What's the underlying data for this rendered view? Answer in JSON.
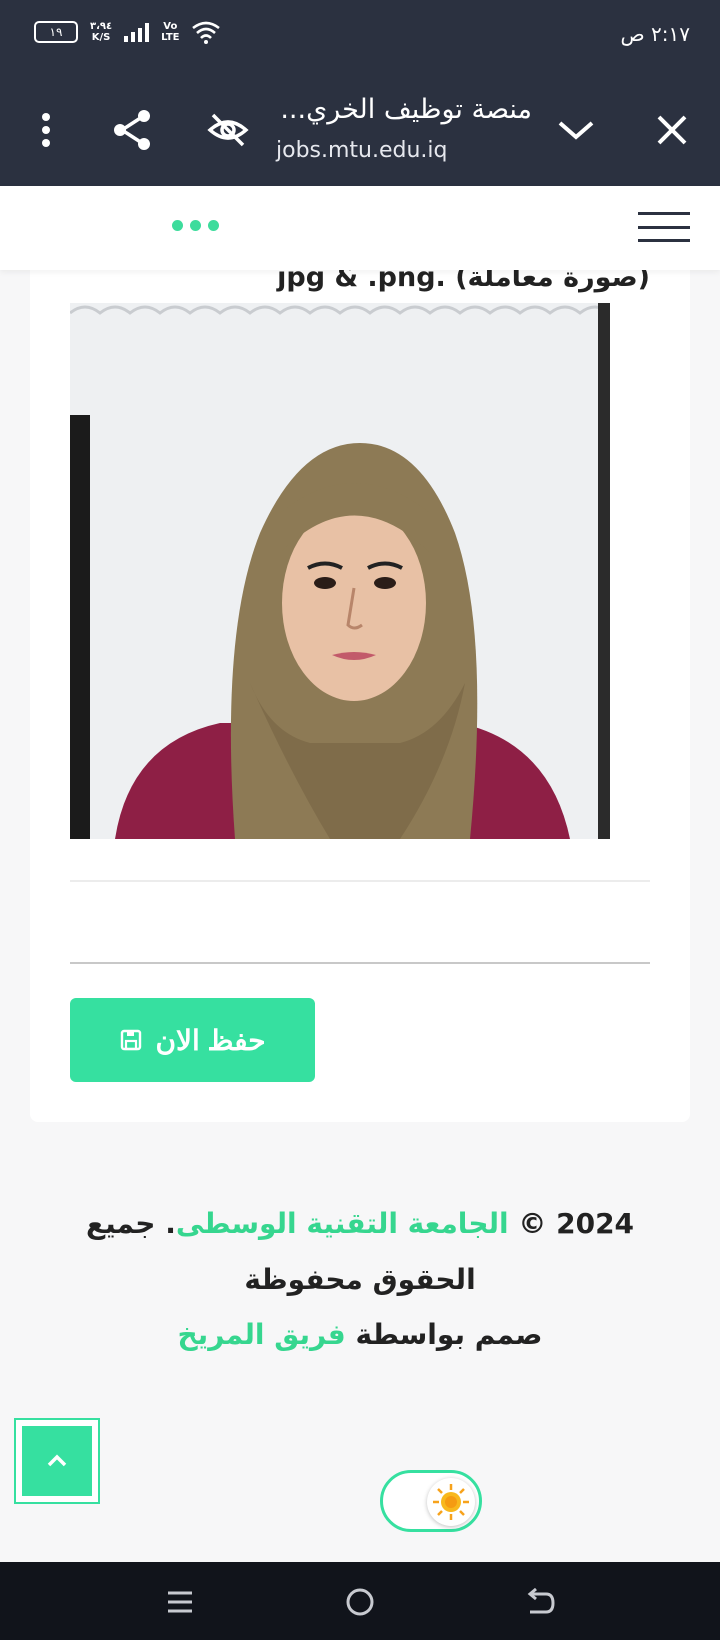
{
  "status_bar": {
    "time": "٢:١٧ ص",
    "battery": "١٩",
    "net_speed_value": "٣،٩٤",
    "net_speed_unit": "K/S",
    "volte_top": "Vo",
    "volte_bottom": "LTE"
  },
  "browser": {
    "tab_title": "منصة توظيف الخري...",
    "url": "jobs.mtu.edu.iq"
  },
  "form": {
    "upload_hint": "jpg & .png. (صورة معاملة)",
    "save_label": "حفظ الان"
  },
  "footer": {
    "year": "2024 ©",
    "university": "الجامعة التقنية الوسطى",
    "rights": ". جميع الحقوق محفوظة",
    "designed_by": "صمم بواسطة",
    "team": "فريق المريخ"
  },
  "colors": {
    "accent": "#36e0a0",
    "browser_bar": "#2b3140",
    "nav_bar": "#11141b"
  },
  "icons": {
    "save": "floppy-disk-icon",
    "back_to_top": "chevron-up-icon",
    "theme": "sun-icon",
    "share": "share-icon",
    "hidden": "eye-off-icon",
    "menu": "more-vertical-icon"
  }
}
